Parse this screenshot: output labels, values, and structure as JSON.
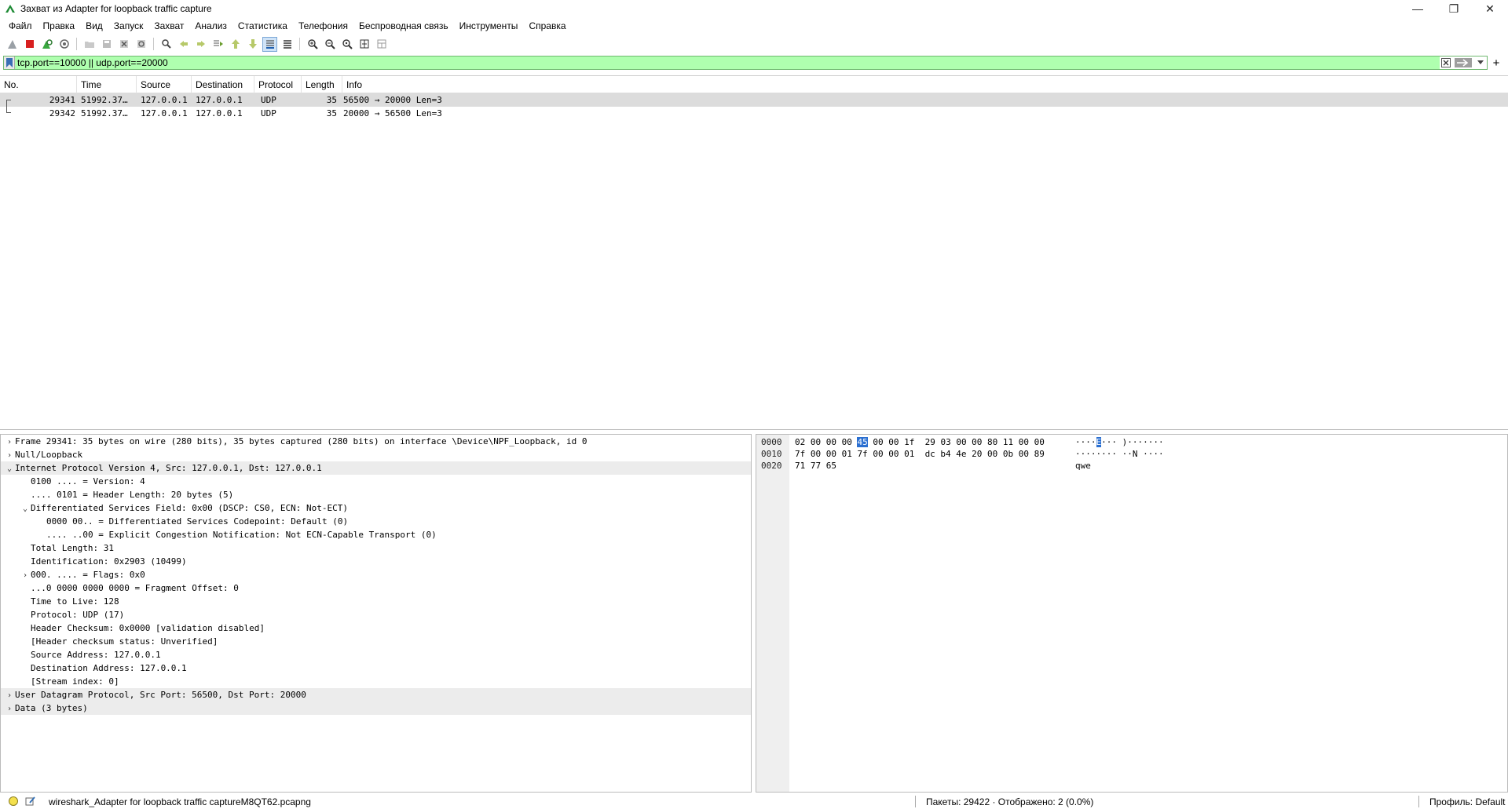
{
  "window": {
    "title": "Захват из Adapter for loopback traffic capture",
    "minimize": "—",
    "maximize": "❐",
    "close": "✕"
  },
  "menu": [
    "Файл",
    "Правка",
    "Вид",
    "Запуск",
    "Захват",
    "Анализ",
    "Статистика",
    "Телефония",
    "Беспроводная связь",
    "Инструменты",
    "Справка"
  ],
  "toolbar": {
    "icons": [
      "shark-fin-start-icon",
      "stop-capture-icon",
      "restart-capture-icon",
      "capture-options-icon",
      "open-file-icon",
      "save-file-icon",
      "close-file-icon",
      "reload-file-icon",
      "find-packet-icon",
      "go-back-icon",
      "go-forward-icon",
      "go-to-packet-icon",
      "go-first-icon",
      "go-last-icon",
      "autoscroll-icon",
      "colorize-icon",
      "zoom-in-icon",
      "zoom-out-icon",
      "zoom-normal-icon",
      "resize-columns-icon",
      "layout-icon"
    ]
  },
  "filter": {
    "value": "tcp.port==10000 || udp.port==20000",
    "plus": "+"
  },
  "packet_list": {
    "columns": [
      "No.",
      "Time",
      "Source",
      "Destination",
      "Protocol",
      "Length",
      "Info"
    ],
    "rows": [
      {
        "no": "29341",
        "time": "51992.37…",
        "source": "127.0.0.1",
        "destination": "127.0.0.1",
        "protocol": "UDP",
        "length": "35",
        "info": "56500 → 20000 Len=3",
        "selected": true
      },
      {
        "no": "29342",
        "time": "51992.37…",
        "source": "127.0.0.1",
        "destination": "127.0.0.1",
        "protocol": "UDP",
        "length": "35",
        "info": "20000 → 56500 Len=3",
        "selected": false
      }
    ]
  },
  "details": [
    {
      "indent": 0,
      "twisty": "›",
      "text": "Frame 29341: 35 bytes on wire (280 bits), 35 bytes captured (280 bits) on interface \\Device\\NPF_Loopback, id 0",
      "hl": false
    },
    {
      "indent": 0,
      "twisty": "›",
      "text": "Null/Loopback",
      "hl": false
    },
    {
      "indent": 0,
      "twisty": "⌄",
      "text": "Internet Protocol Version 4, Src: 127.0.0.1, Dst: 127.0.0.1",
      "hl": true
    },
    {
      "indent": 1,
      "twisty": "",
      "text": "0100 .... = Version: 4",
      "hl": false
    },
    {
      "indent": 1,
      "twisty": "",
      "text": ".... 0101 = Header Length: 20 bytes (5)",
      "hl": false
    },
    {
      "indent": 1,
      "twisty": "⌄",
      "text": "Differentiated Services Field: 0x00 (DSCP: CS0, ECN: Not-ECT)",
      "hl": false
    },
    {
      "indent": 2,
      "twisty": "",
      "text": "0000 00.. = Differentiated Services Codepoint: Default (0)",
      "hl": false
    },
    {
      "indent": 2,
      "twisty": "",
      "text": ".... ..00 = Explicit Congestion Notification: Not ECN-Capable Transport (0)",
      "hl": false
    },
    {
      "indent": 1,
      "twisty": "",
      "text": "Total Length: 31",
      "hl": false
    },
    {
      "indent": 1,
      "twisty": "",
      "text": "Identification: 0x2903 (10499)",
      "hl": false
    },
    {
      "indent": 1,
      "twisty": "›",
      "text": "000. .... = Flags: 0x0",
      "hl": false
    },
    {
      "indent": 1,
      "twisty": "",
      "text": "...0 0000 0000 0000 = Fragment Offset: 0",
      "hl": false
    },
    {
      "indent": 1,
      "twisty": "",
      "text": "Time to Live: 128",
      "hl": false
    },
    {
      "indent": 1,
      "twisty": "",
      "text": "Protocol: UDP (17)",
      "hl": false
    },
    {
      "indent": 1,
      "twisty": "",
      "text": "Header Checksum: 0x0000 [validation disabled]",
      "hl": false
    },
    {
      "indent": 1,
      "twisty": "",
      "text": "[Header checksum status: Unverified]",
      "hl": false
    },
    {
      "indent": 1,
      "twisty": "",
      "text": "Source Address: 127.0.0.1",
      "hl": false
    },
    {
      "indent": 1,
      "twisty": "",
      "text": "Destination Address: 127.0.0.1",
      "hl": false
    },
    {
      "indent": 1,
      "twisty": "",
      "text": "[Stream index: 0]",
      "hl": false
    },
    {
      "indent": 0,
      "twisty": "›",
      "text": "User Datagram Protocol, Src Port: 56500, Dst Port: 20000",
      "hl": true
    },
    {
      "indent": 0,
      "twisty": "›",
      "text": "Data (3 bytes)",
      "hl": true
    }
  ],
  "bytes": [
    {
      "offset": "0000",
      "hex_pre": "02 00 00 00 ",
      "hex_sel": "45",
      "hex_post": " 00 00 1f  29 03 00 00 80 11 00 00",
      "ascii_pre": "····",
      "ascii_sel": "E",
      "ascii_post": "··· )·······"
    },
    {
      "offset": "0010",
      "hex_pre": "7f 00 00 01 7f 00 00 01  dc b4 4e 20 00 0b 00 89",
      "hex_sel": "",
      "hex_post": "",
      "ascii_pre": "········ ··N ····",
      "ascii_sel": "",
      "ascii_post": ""
    },
    {
      "offset": "0020",
      "hex_pre": "71 77 65",
      "hex_sel": "",
      "hex_post": "",
      "ascii_pre": "qwe",
      "ascii_sel": "",
      "ascii_post": ""
    }
  ],
  "status": {
    "file": "wireshark_Adapter for loopback traffic captureM8QT62.pcapng",
    "packets": "Пакеты: 29422 · Отображено: 2 (0.0%)",
    "profile": "Профиль: Default"
  }
}
